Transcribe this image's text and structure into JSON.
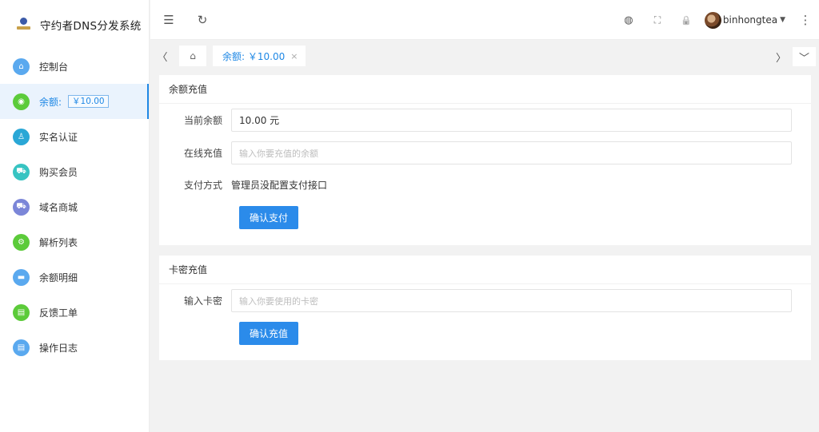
{
  "app": {
    "title": "守约者DNS分发系统"
  },
  "sidebar": {
    "items": [
      {
        "label": "控制台",
        "icon": "home-icon",
        "color": "#5aa9ef"
      },
      {
        "label": "余额:",
        "badge": "￥10.00",
        "icon": "wallet-icon",
        "color": "#5ccb3a"
      },
      {
        "label": "实名认证",
        "icon": "user-icon",
        "color": "#2aa7d6"
      },
      {
        "label": "购买会员",
        "icon": "cart-icon",
        "color": "#37c4c2"
      },
      {
        "label": "域名商城",
        "icon": "shop-icon",
        "color": "#7b86d8"
      },
      {
        "label": "解析列表",
        "icon": "list-icon",
        "color": "#5ccb3a"
      },
      {
        "label": "余额明细",
        "icon": "detail-icon",
        "color": "#5aa9ef"
      },
      {
        "label": "反馈工单",
        "icon": "ticket-icon",
        "color": "#5ccb3a"
      },
      {
        "label": "操作日志",
        "icon": "log-icon",
        "color": "#5aa9ef"
      }
    ]
  },
  "header": {
    "menu_icon": "☰",
    "refresh_icon": "↻",
    "globe_icon": "◍",
    "fullscreen_icon": "⛶",
    "lock_icon": "🔒",
    "more_icon": "⋮",
    "username": "binhongtea"
  },
  "tabs": {
    "items": [
      {
        "label": "余额: ￥10.00",
        "close": "×"
      }
    ]
  },
  "recharge": {
    "title": "余额充值",
    "current_label": "当前余额",
    "current_value": "10.00 元",
    "online_label": "在线充值",
    "online_placeholder": "输入你要充值的余额",
    "pay_label": "支付方式",
    "pay_value": "管理员没配置支付接口",
    "confirm_button": "确认支付"
  },
  "card_recharge": {
    "title": "卡密充值",
    "input_label": "输入卡密",
    "input_placeholder": "输入你要使用的卡密",
    "confirm_button": "确认充值"
  },
  "colors": {
    "accent": "#1f88e5",
    "button": "#2b8bea"
  }
}
